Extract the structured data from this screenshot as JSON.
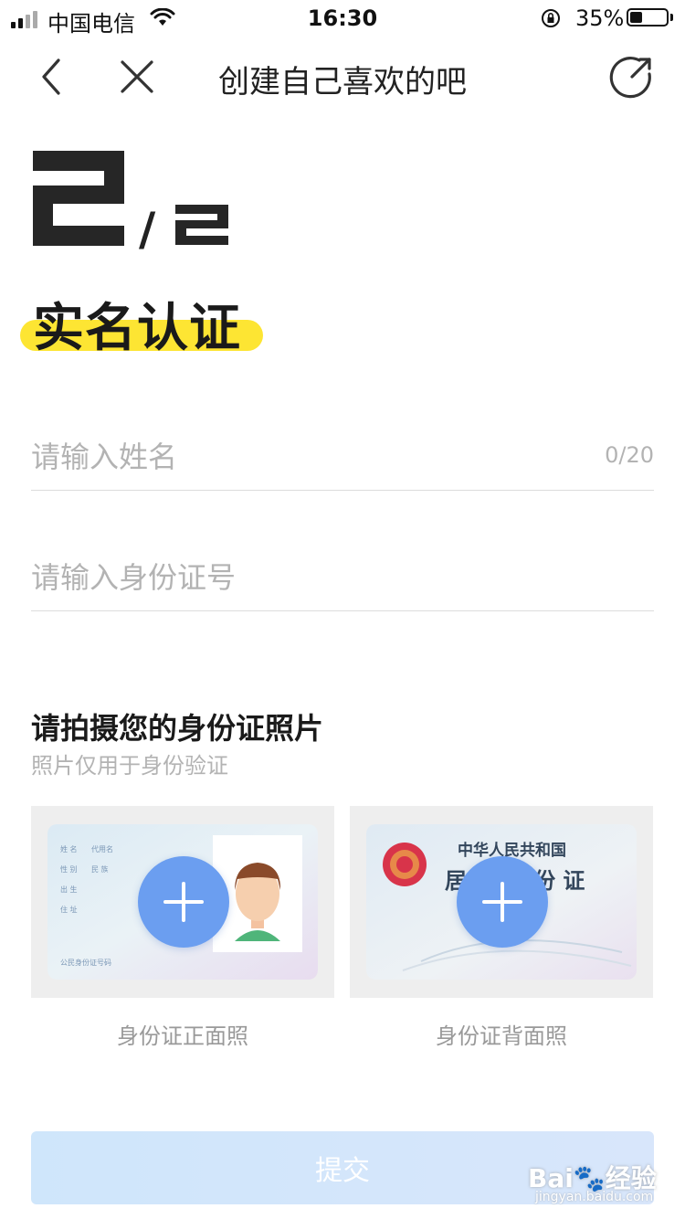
{
  "status_bar": {
    "carrier": "中国电信",
    "time": "16:30",
    "battery_percent": "35%",
    "battery_level": 0.35
  },
  "nav": {
    "title": "创建自己喜欢的吧",
    "back_icon": "chevron-left-icon",
    "close_icon": "close-icon",
    "share_icon": "share-icon"
  },
  "step": {
    "current": "2",
    "total": "2",
    "separator": "/"
  },
  "page": {
    "title": "实名认证",
    "highlight_color": "#fde533"
  },
  "form": {
    "name_placeholder": "请输入姓名",
    "name_counter": "0/20",
    "id_placeholder": "请输入身份证号"
  },
  "photos": {
    "title": "请拍摄您的身份证照片",
    "subtitle": "照片仅用于身份验证",
    "front_label": "身份证正面照",
    "back_label": "身份证背面照",
    "front_card_text": [
      "姓 名",
      "代用名",
      "性 别",
      "民 族",
      "出 生",
      "住 址",
      "公民身份证号码"
    ],
    "back_card_text": [
      "中华人民共和国",
      "居 民 身 份 证"
    ],
    "plus_color": "#6b9ef0"
  },
  "submit": {
    "label": "提交"
  },
  "watermark": {
    "text": "Bai🐾经验",
    "sub": "jingyan.baidu.com"
  }
}
